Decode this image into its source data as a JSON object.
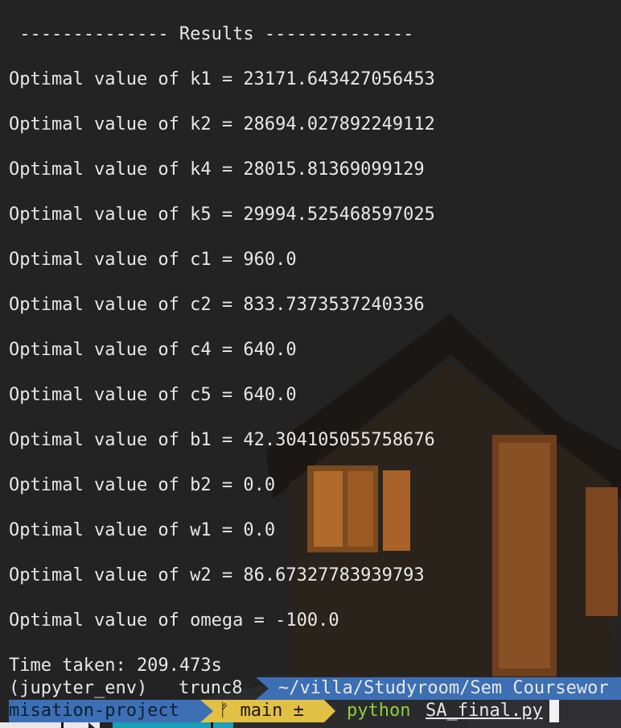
{
  "terminal": {
    "results_header": " -------------- Results --------------",
    "results": [
      "Optimal value of k1 = 23171.643427056453",
      "Optimal value of k2 = 28694.027892249112",
      "Optimal value of k4 = 28015.81369099129",
      "Optimal value of k5 = 29994.525468597025",
      "Optimal value of c1 = 960.0",
      "Optimal value of c2 = 833.7373537240336",
      "Optimal value of c4 = 640.0",
      "Optimal value of c5 = 640.0",
      "Optimal value of b1 = 42.304105055758676",
      "Optimal value of b2 = 0.0",
      "Optimal value of w1 = 0.0",
      "Optimal value of w2 = 86.67327783939793",
      "Optimal value of omega = -100.0"
    ],
    "time_taken": "Time taken: 209.473s"
  },
  "prompt": {
    "env": "(jupyter_env)",
    "user": "trunc8",
    "path": "~/villa/Studyroom/Sem Coursewor",
    "project": "misation-project",
    "git": "ᚠ main ±",
    "command": "python",
    "argument": "SA_final.py"
  },
  "colors": {
    "background": "#232323",
    "path_segment": "#3d6fb5",
    "git_segment": "#e2c044",
    "command": "#8ecf3c"
  }
}
